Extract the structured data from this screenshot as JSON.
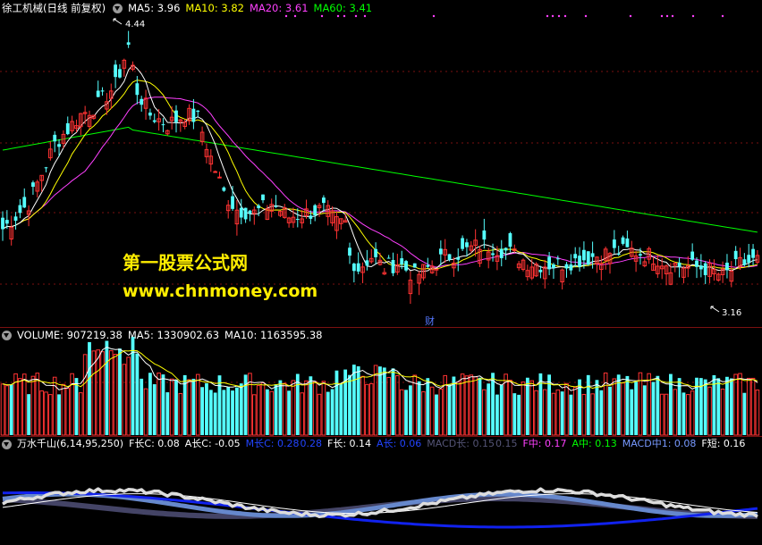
{
  "price": {
    "stock_name": "徐工机械(日线 前复权)",
    "ma_labels": [
      {
        "text": "MA5: 3.96",
        "color": "#ffffff"
      },
      {
        "text": "MA10: 3.82",
        "color": "#ffff00"
      },
      {
        "text": "MA20: 3.61",
        "color": "#ff40ff"
      },
      {
        "text": "MA60: 3.41",
        "color": "#00ff00"
      }
    ],
    "high_label": "4.44",
    "low_label": "3.16",
    "financial_marker": "财"
  },
  "watermark": {
    "line1": "第一股票公式网",
    "line2": "www.chnmoney.com"
  },
  "volume": {
    "labels": [
      {
        "text": "VOLUME: 907219.38",
        "color": "#ffffff"
      },
      {
        "text": "MA5: 1330902.63",
        "color": "#ffffff"
      },
      {
        "text": "MA10: 1163595.38",
        "color": "#ffffff"
      }
    ]
  },
  "indicator": {
    "name": "万水千山(6,14,95,250)",
    "labels": [
      {
        "text": "F长C: 0.08",
        "color": "#ffffff"
      },
      {
        "text": "A长C: -0.05",
        "color": "#ffffff"
      },
      {
        "text": "M长C: 0.28",
        "color": "#2244ff"
      },
      {
        "text": "0.28",
        "color": "#2244ff"
      },
      {
        "text": "F长: 0.14",
        "color": "#ffffff"
      },
      {
        "text": "A长: 0.06",
        "color": "#2244ff"
      },
      {
        "text": "MACD长: 0.15",
        "color": "#555577"
      },
      {
        "text": "0.15",
        "color": "#555577"
      },
      {
        "text": "F中: 0.17",
        "color": "#ff40ff"
      },
      {
        "text": "A中: 0.13",
        "color": "#00ff00"
      },
      {
        "text": "MACD中1: 0.08",
        "color": "#7799ff"
      },
      {
        "text": "F短: 0.16",
        "color": "#ffffff"
      }
    ]
  },
  "colors": {
    "up": "#ff3333",
    "down": "#55ffff",
    "ma5": "#ffffff",
    "ma10": "#ffff00",
    "ma20": "#ff40ff",
    "ma60": "#00ff00",
    "grid": "#7a1010"
  },
  "icons": [
    "collapse-triangle-icon",
    "high-arrow-icon",
    "low-arrow-icon",
    "signal-dot-icon"
  ]
}
